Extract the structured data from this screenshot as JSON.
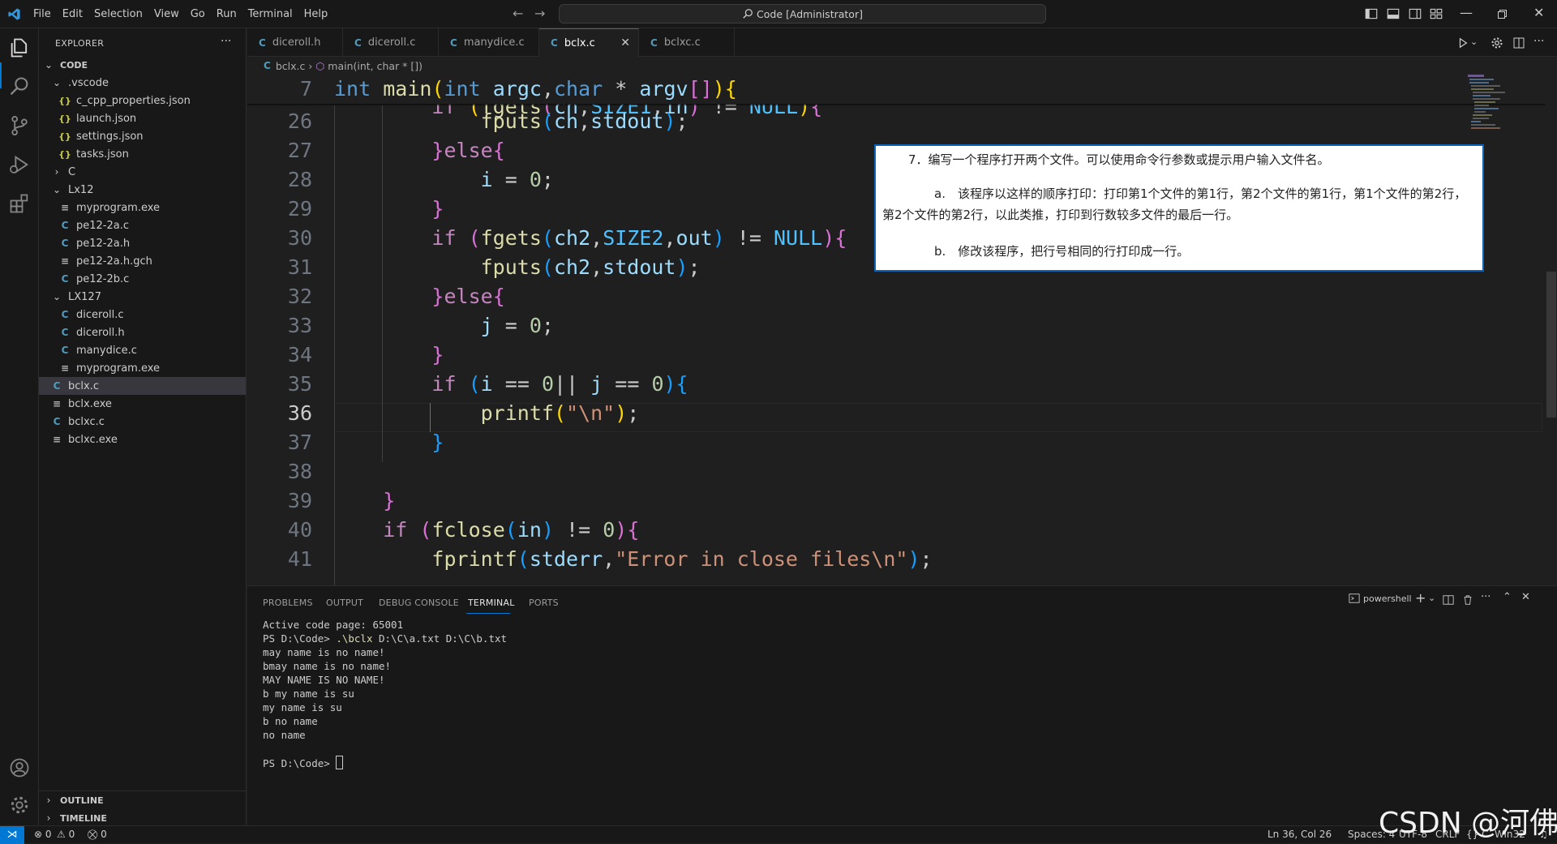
{
  "titlebar": {
    "menu": [
      "File",
      "Edit",
      "Selection",
      "View",
      "Go",
      "Run",
      "Terminal",
      "Help"
    ],
    "search": "Code [Administrator]"
  },
  "sidebar": {
    "title": "EXPLORER",
    "more": "···",
    "root": "CODE",
    "items": [
      {
        "label": ".vscode",
        "icon": "chevron-down-icon",
        "indent": 1
      },
      {
        "label": "c_cpp_properties.json",
        "icon": "json-file-icon",
        "indent": 2
      },
      {
        "label": "launch.json",
        "icon": "json-file-icon",
        "indent": 2
      },
      {
        "label": "settings.json",
        "icon": "json-file-icon",
        "indent": 2
      },
      {
        "label": "tasks.json",
        "icon": "json-file-icon",
        "indent": 2
      },
      {
        "label": "C",
        "icon": "chevron-right-icon",
        "indent": 1
      },
      {
        "label": "Lx12",
        "icon": "chevron-down-icon",
        "indent": 1
      },
      {
        "label": "myprogram.exe",
        "icon": "exe-file-icon",
        "indent": 2
      },
      {
        "label": "pe12-2a.c",
        "icon": "c-file-icon",
        "indent": 2
      },
      {
        "label": "pe12-2a.h",
        "icon": "c-file-icon",
        "indent": 2
      },
      {
        "label": "pe12-2a.h.gch",
        "icon": "exe-file-icon",
        "indent": 2
      },
      {
        "label": "pe12-2b.c",
        "icon": "c-file-icon",
        "indent": 2
      },
      {
        "label": "LX127",
        "icon": "chevron-down-icon",
        "indent": 1
      },
      {
        "label": "diceroll.c",
        "icon": "c-file-icon",
        "indent": 2
      },
      {
        "label": "diceroll.h",
        "icon": "c-file-icon",
        "indent": 2
      },
      {
        "label": "manydice.c",
        "icon": "c-file-icon",
        "indent": 2
      },
      {
        "label": "myprogram.exe",
        "icon": "exe-file-icon",
        "indent": 2
      },
      {
        "label": "bclx.c",
        "icon": "c-file-icon",
        "indent": 1,
        "selected": true
      },
      {
        "label": "bclx.exe",
        "icon": "exe-file-icon",
        "indent": 1
      },
      {
        "label": "bclxc.c",
        "icon": "c-file-icon",
        "indent": 1
      },
      {
        "label": "bclxc.exe",
        "icon": "exe-file-icon",
        "indent": 1
      }
    ],
    "outline": "OUTLINE",
    "timeline": "TIMELINE"
  },
  "tabs": [
    {
      "label": "diceroll.h",
      "active": false
    },
    {
      "label": "diceroll.c",
      "active": false
    },
    {
      "label": "manydice.c",
      "active": false
    },
    {
      "label": "bclx.c",
      "active": true
    },
    {
      "label": "bclxc.c",
      "active": false
    }
  ],
  "breadcrumb": {
    "file": "bclx.c",
    "symbol": "main(int, char * [])"
  },
  "editor": {
    "sticky_line": "7",
    "line_numbers": [
      "26",
      "27",
      "28",
      "29",
      "30",
      "31",
      "32",
      "33",
      "34",
      "35",
      "36",
      "37",
      "38",
      "39",
      "40",
      "41"
    ],
    "current_line": "36"
  },
  "note": {
    "line1": "7．编写一个程序打开两个文件。可以使用命令行参数或提示用户输入文件名。",
    "line2": "a.　该程序以这样的顺序打印：打印第1个文件的第1行，第2个文件的第1行，第1个文件的第2行，第2个文件的第2行，以此类推，打印到行数较多文件的最后一行。",
    "line3": "b.　修改该程序，把行号相同的行打印成一行。"
  },
  "panel": {
    "tabs": [
      "PROBLEMS",
      "OUTPUT",
      "DEBUG CONSOLE",
      "TERMINAL",
      "PORTS"
    ],
    "active_tab": "TERMINAL",
    "shell": "powershell",
    "terminal": {
      "l1": "Active code page: 65001",
      "prompt1": "PS D:\\Code> ",
      "cmd": ".\\bclx",
      "args": " D:\\C\\a.txt D:\\C\\b.txt",
      "out": [
        "may name is no name!",
        "bmay name is no name!",
        "MAY NAME IS NO NAME!",
        "b my name is su",
        "my name is su",
        "b no name",
        "no name"
      ],
      "prompt2": "PS D:\\Code> "
    }
  },
  "status": {
    "errors": "0",
    "warnings": "0",
    "ports": "0",
    "position": "Ln 36, Col 26",
    "spaces": "Spaces: 4",
    "encoding": "UTF-8",
    "eol": "CRLF",
    "lang": "C",
    "platform": "Win32"
  },
  "watermark": "CSDN @河佛",
  "colors": {
    "accent": "#0078d4",
    "c_icon": "#519aba",
    "json_icon": "#cbcb41"
  }
}
